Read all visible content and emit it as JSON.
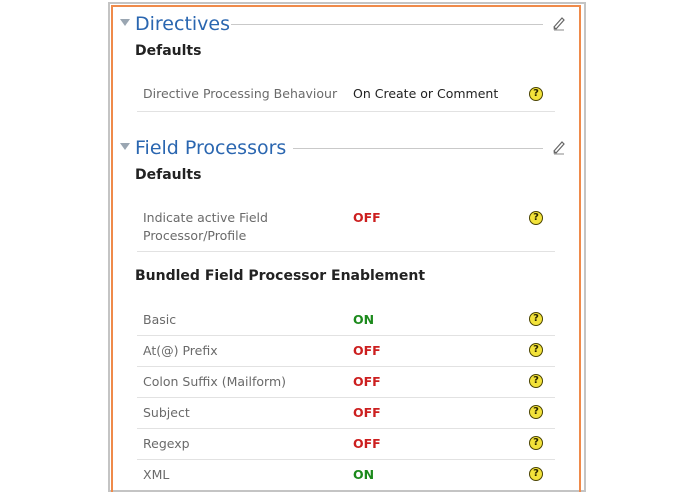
{
  "directives": {
    "title": "Directives",
    "defaults_heading": "Defaults",
    "rows": [
      {
        "label": "Directive Processing Behaviour",
        "value": "On Create or Comment"
      }
    ]
  },
  "field_processors": {
    "title": "Field Processors",
    "defaults_heading": "Defaults",
    "defaults_rows": [
      {
        "label": "Indicate active Field Processor/Profile",
        "value": "OFF"
      }
    ],
    "bundled_heading": "Bundled Field Processor Enablement",
    "bundled_rows": [
      {
        "label": "Basic",
        "value": "ON"
      },
      {
        "label": "At(@) Prefix",
        "value": "OFF"
      },
      {
        "label": "Colon Suffix (Mailform)",
        "value": "OFF"
      },
      {
        "label": "Subject",
        "value": "OFF"
      },
      {
        "label": "Regexp",
        "value": "OFF"
      },
      {
        "label": "XML",
        "value": "ON"
      }
    ]
  },
  "help_glyph": "?",
  "icons": {
    "collapse": "triangle-down-icon",
    "edit": "pencil-icon",
    "help": "help-icon"
  },
  "colors": {
    "accent_border": "#ef8a4a",
    "title": "#2a66b0",
    "on": "#1c8a1c",
    "off": "#cc1f1f",
    "help_bg": "#f2e23a"
  }
}
